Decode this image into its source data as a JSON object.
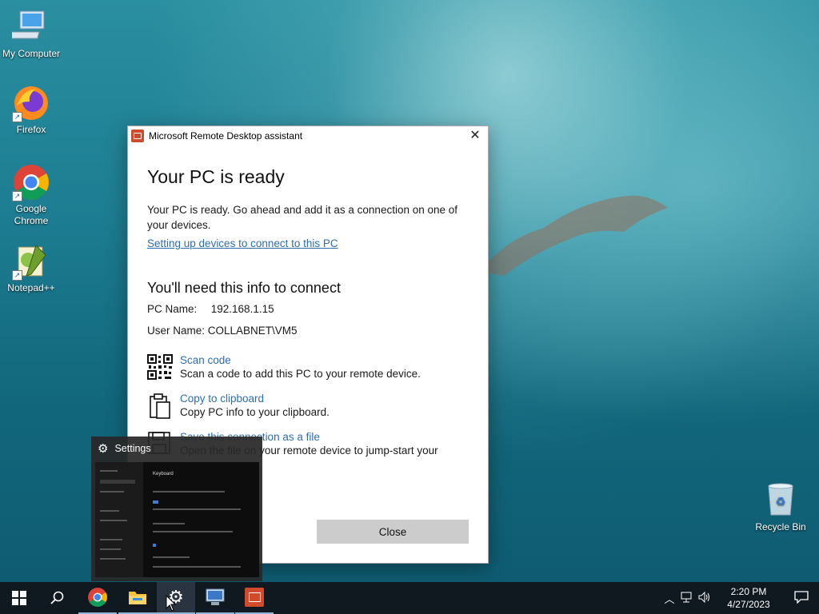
{
  "desktop": {
    "icons": [
      {
        "label": "My Computer"
      },
      {
        "label": "Firefox"
      },
      {
        "label": "Google Chrome"
      },
      {
        "label": "Notepad++"
      }
    ],
    "recycle_bin": "Recycle Bin"
  },
  "dialog": {
    "title": "Microsoft Remote Desktop assistant",
    "close_glyph": "✕",
    "heading": "Your PC is ready",
    "description": "Your PC is ready. Go ahead and add it as a connection on one of your devices.",
    "setup_link": "Setting up devices to connect to this PC",
    "info_heading": "You'll need this info to connect",
    "pc_name_label": "PC Name:",
    "pc_name_value": "192.168.1.15",
    "user_name_label": "User Name:",
    "user_name_value": "COLLABNET\\VM5",
    "actions": [
      {
        "title": "Scan code",
        "desc": "Scan a code to add this PC to your remote device.",
        "icon": "qr-code-icon"
      },
      {
        "title": "Copy to clipboard",
        "desc": "Copy PC info to your clipboard.",
        "icon": "clipboard-icon"
      },
      {
        "title": "Save this connection as a file",
        "desc": "Open the file on your remote device to jump-start your",
        "icon": "save-disk-icon"
      }
    ],
    "close_button": "Close"
  },
  "thumbnail": {
    "title": "Settings",
    "preview_heading": "Keyboard"
  },
  "taskbar": {
    "time": "2:20 PM",
    "date": "4/27/2023"
  },
  "colors": {
    "link": "#2e6dae",
    "taskbar": "#101820",
    "app_accent": "#d04a2c"
  }
}
